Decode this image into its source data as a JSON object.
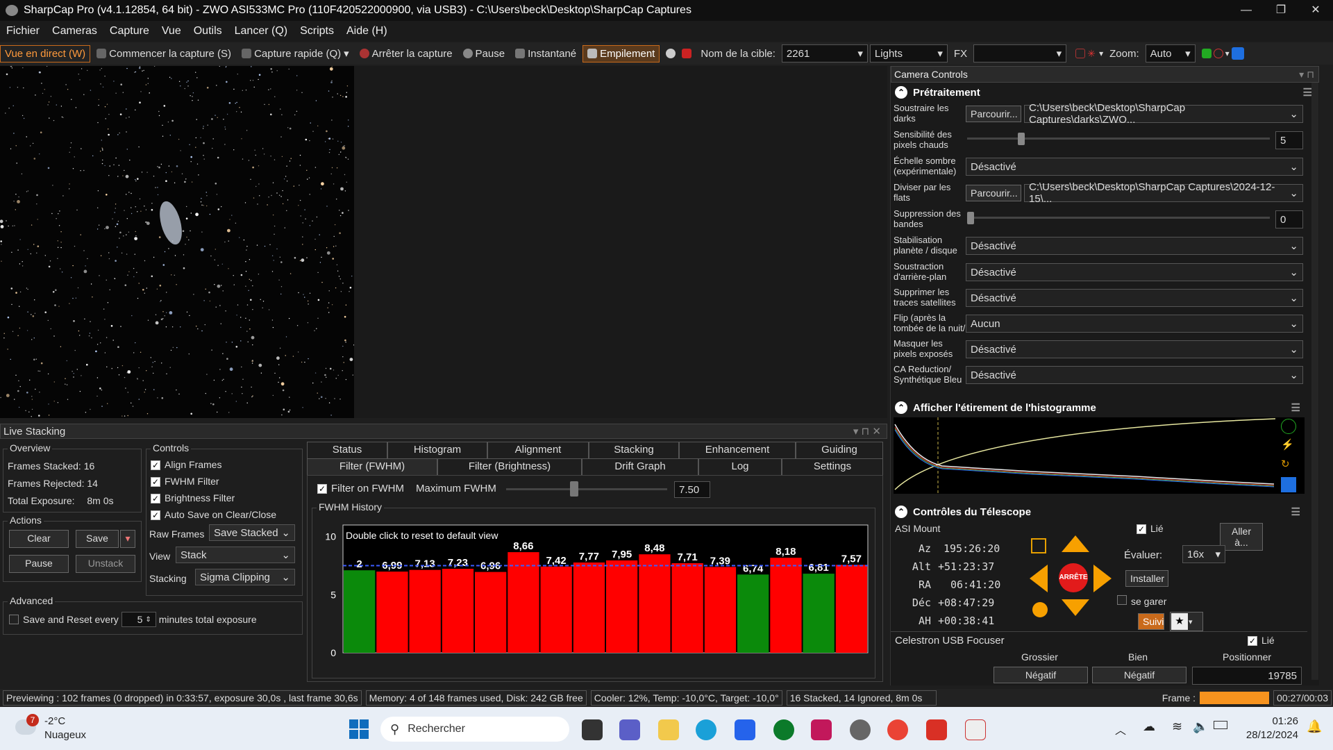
{
  "window": {
    "title": "SharpCap Pro (v4.1.12854, 64 bit) - ZWO ASI533MC Pro (110F420522000900, via USB3) - C:\\Users\\beck\\Desktop\\SharpCap Captures",
    "min": "—",
    "max": "❐",
    "close": "✕"
  },
  "menu": [
    "Fichier",
    "Cameras",
    "Capture",
    "Vue",
    "Outils",
    "Lancer (Q)",
    "Scripts",
    "Aide (H)"
  ],
  "toolbar": {
    "live": "Vue en direct (W)",
    "start": "Commencer la capture (S)",
    "quick": "Capture rapide (Q)",
    "stop": "Arrêter la capture",
    "pause": "Pause",
    "snapshot": "Instantané",
    "stack": "Empilement",
    "target_label": "Nom de la cible:",
    "target_value": "2261",
    "frame_type": "Lights",
    "fx_label": "FX",
    "fx_value": "",
    "zoom_label": "Zoom:",
    "zoom_value": "Auto"
  },
  "camera_controls": {
    "title": "Camera Controls",
    "pre": {
      "title": "Prétraitement",
      "rows": [
        {
          "label": "Soustraire les darks",
          "button": "Parcourir...",
          "value": "C:\\Users\\beck\\Desktop\\SharpCap Captures\\darks\\ZWO..."
        },
        {
          "label": "Sensibilité des pixels chauds",
          "value": "5"
        },
        {
          "label": "Échelle sombre (expérimentale)",
          "value": "Désactivé"
        },
        {
          "label": "Diviser par les flats",
          "button": "Parcourir...",
          "value": "C:\\Users\\beck\\Desktop\\SharpCap Captures\\2024-12-15\\..."
        },
        {
          "label": "Suppression des bandes",
          "value": "0"
        },
        {
          "label": "Stabilisation planète / disque",
          "value": "Désactivé"
        },
        {
          "label": "Soustraction d'arrière-plan",
          "value": "Désactivé"
        },
        {
          "label": "Supprimer les traces satellites",
          "value": "Désactivé"
        },
        {
          "label": "Flip (après la tombée de la nuit/à plat)",
          "value": "Aucun"
        },
        {
          "label": "Masquer les pixels exposés",
          "value": "Désactivé"
        },
        {
          "label": "CA Reduction/ Synthétique Bleu",
          "value": "Désactivé"
        }
      ]
    },
    "hist": {
      "title": "Afficher l'étirement de l'histogramme"
    },
    "tele": {
      "title": "Contrôles du Télescope",
      "mount": "ASI Mount",
      "lie": "Lié",
      "goto": "Aller à...",
      "eval_label": "Évaluer:",
      "eval_value": "16x",
      "install": "Installer",
      "garer": "se garer",
      "stop": "ARRÊTE",
      "suivi": "Suivi",
      "coords": [
        {
          "k": "Az",
          "v": "195:26:20"
        },
        {
          "k": "Alt",
          "v": "+51:23:37"
        },
        {
          "k": "RA",
          "v": "06:41:20"
        },
        {
          "k": "Déc",
          "v": "+08:47:29"
        },
        {
          "k": "AH",
          "v": "+00:38:41"
        }
      ]
    },
    "focuser": {
      "title": "Celestron USB Focuser",
      "lie": "Lié",
      "col1": "Grossier",
      "col2": "Bien",
      "col3": "Positionner",
      "b1": "Négatif",
      "b2": "Négatif",
      "pos": "19785"
    }
  },
  "live_stacking": {
    "title": "Live Stacking",
    "overview": {
      "title": "Overview",
      "stacked_label": "Frames Stacked:",
      "stacked": "16",
      "rejected_label": "Frames Rejected:",
      "rejected": "14",
      "exposure_label": "Total Exposure:",
      "exposure": "8m 0s"
    },
    "actions": {
      "title": "Actions",
      "clear": "Clear",
      "save": "Save",
      "pause": "Pause",
      "unstack": "Unstack"
    },
    "advanced": {
      "title": "Advanced",
      "save_reset": "Save and Reset every",
      "minutes": "5",
      "minutes_label": "minutes total exposure"
    },
    "controls": {
      "title": "Controls",
      "align": "Align Frames",
      "fwhm": "FWHM Filter",
      "brightness": "Brightness Filter",
      "autosave": "Auto Save on Clear/Close",
      "raw_label": "Raw Frames",
      "raw_value": "Save Stacked",
      "view_label": "View",
      "view_value": "Stack",
      "stacking_label": "Stacking",
      "stacking_value": "Sigma Clipping"
    },
    "tabs_top": [
      "Status",
      "Histogram",
      "Alignment",
      "Stacking",
      "Enhancement",
      "Guiding"
    ],
    "tabs_bottom": [
      "Filter (FWHM)",
      "Filter (Brightness)",
      "Drift Graph",
      "Log",
      "Settings"
    ],
    "filter": {
      "enable": "Filter on FWHM",
      "max_label": "Maximum FWHM",
      "max_value": "7.50",
      "history_title": "FWHM History",
      "hint": "Double click to reset to default view"
    }
  },
  "chart_data": {
    "type": "bar",
    "title": "FWHM History",
    "ylim": [
      0,
      11
    ],
    "yticks": [
      0,
      5,
      10
    ],
    "threshold": 7.5,
    "values": [
      7.1,
      6.99,
      7.13,
      7.23,
      6.96,
      8.66,
      7.42,
      7.77,
      7.95,
      8.48,
      7.71,
      7.39,
      6.74,
      8.18,
      6.81,
      7.57
    ],
    "labels": [
      "2",
      "6,99",
      "7,13",
      "7,23",
      "6,96",
      "8,66",
      "7,42",
      "7,77",
      "7,95",
      "8,48",
      "7,71",
      "7,39",
      "6,74",
      "8,18",
      "6,81",
      "7,57"
    ],
    "colors": [
      "#0b8a0b",
      "#ff0000",
      "#ff0000",
      "#ff0000",
      "#ff0000",
      "#ff0000",
      "#ff0000",
      "#ff0000",
      "#ff0000",
      "#ff0000",
      "#ff0000",
      "#ff0000",
      "#0b8a0b",
      "#ff0000",
      "#0b8a0b",
      "#ff0000"
    ]
  },
  "status": {
    "preview": "Previewing : 102 frames (0 dropped) in 0:33:57, exposure 30,0s , last frame 30,6s",
    "memory": "Memory: 4 of 148 frames used, Disk: 242 GB free",
    "cooler": "Cooler: 12%, Temp: -10,0°C, Target: -10,0°",
    "stack": "16 Stacked, 14 Ignored, 8m 0s",
    "frame_label": "Frame :",
    "time": "00:27/00:03"
  },
  "taskbar": {
    "temp": "-2°C",
    "weather": "Nuageux",
    "badge": "7",
    "search": "Rechercher",
    "clock": "01:26",
    "date": "28/12/2024"
  }
}
